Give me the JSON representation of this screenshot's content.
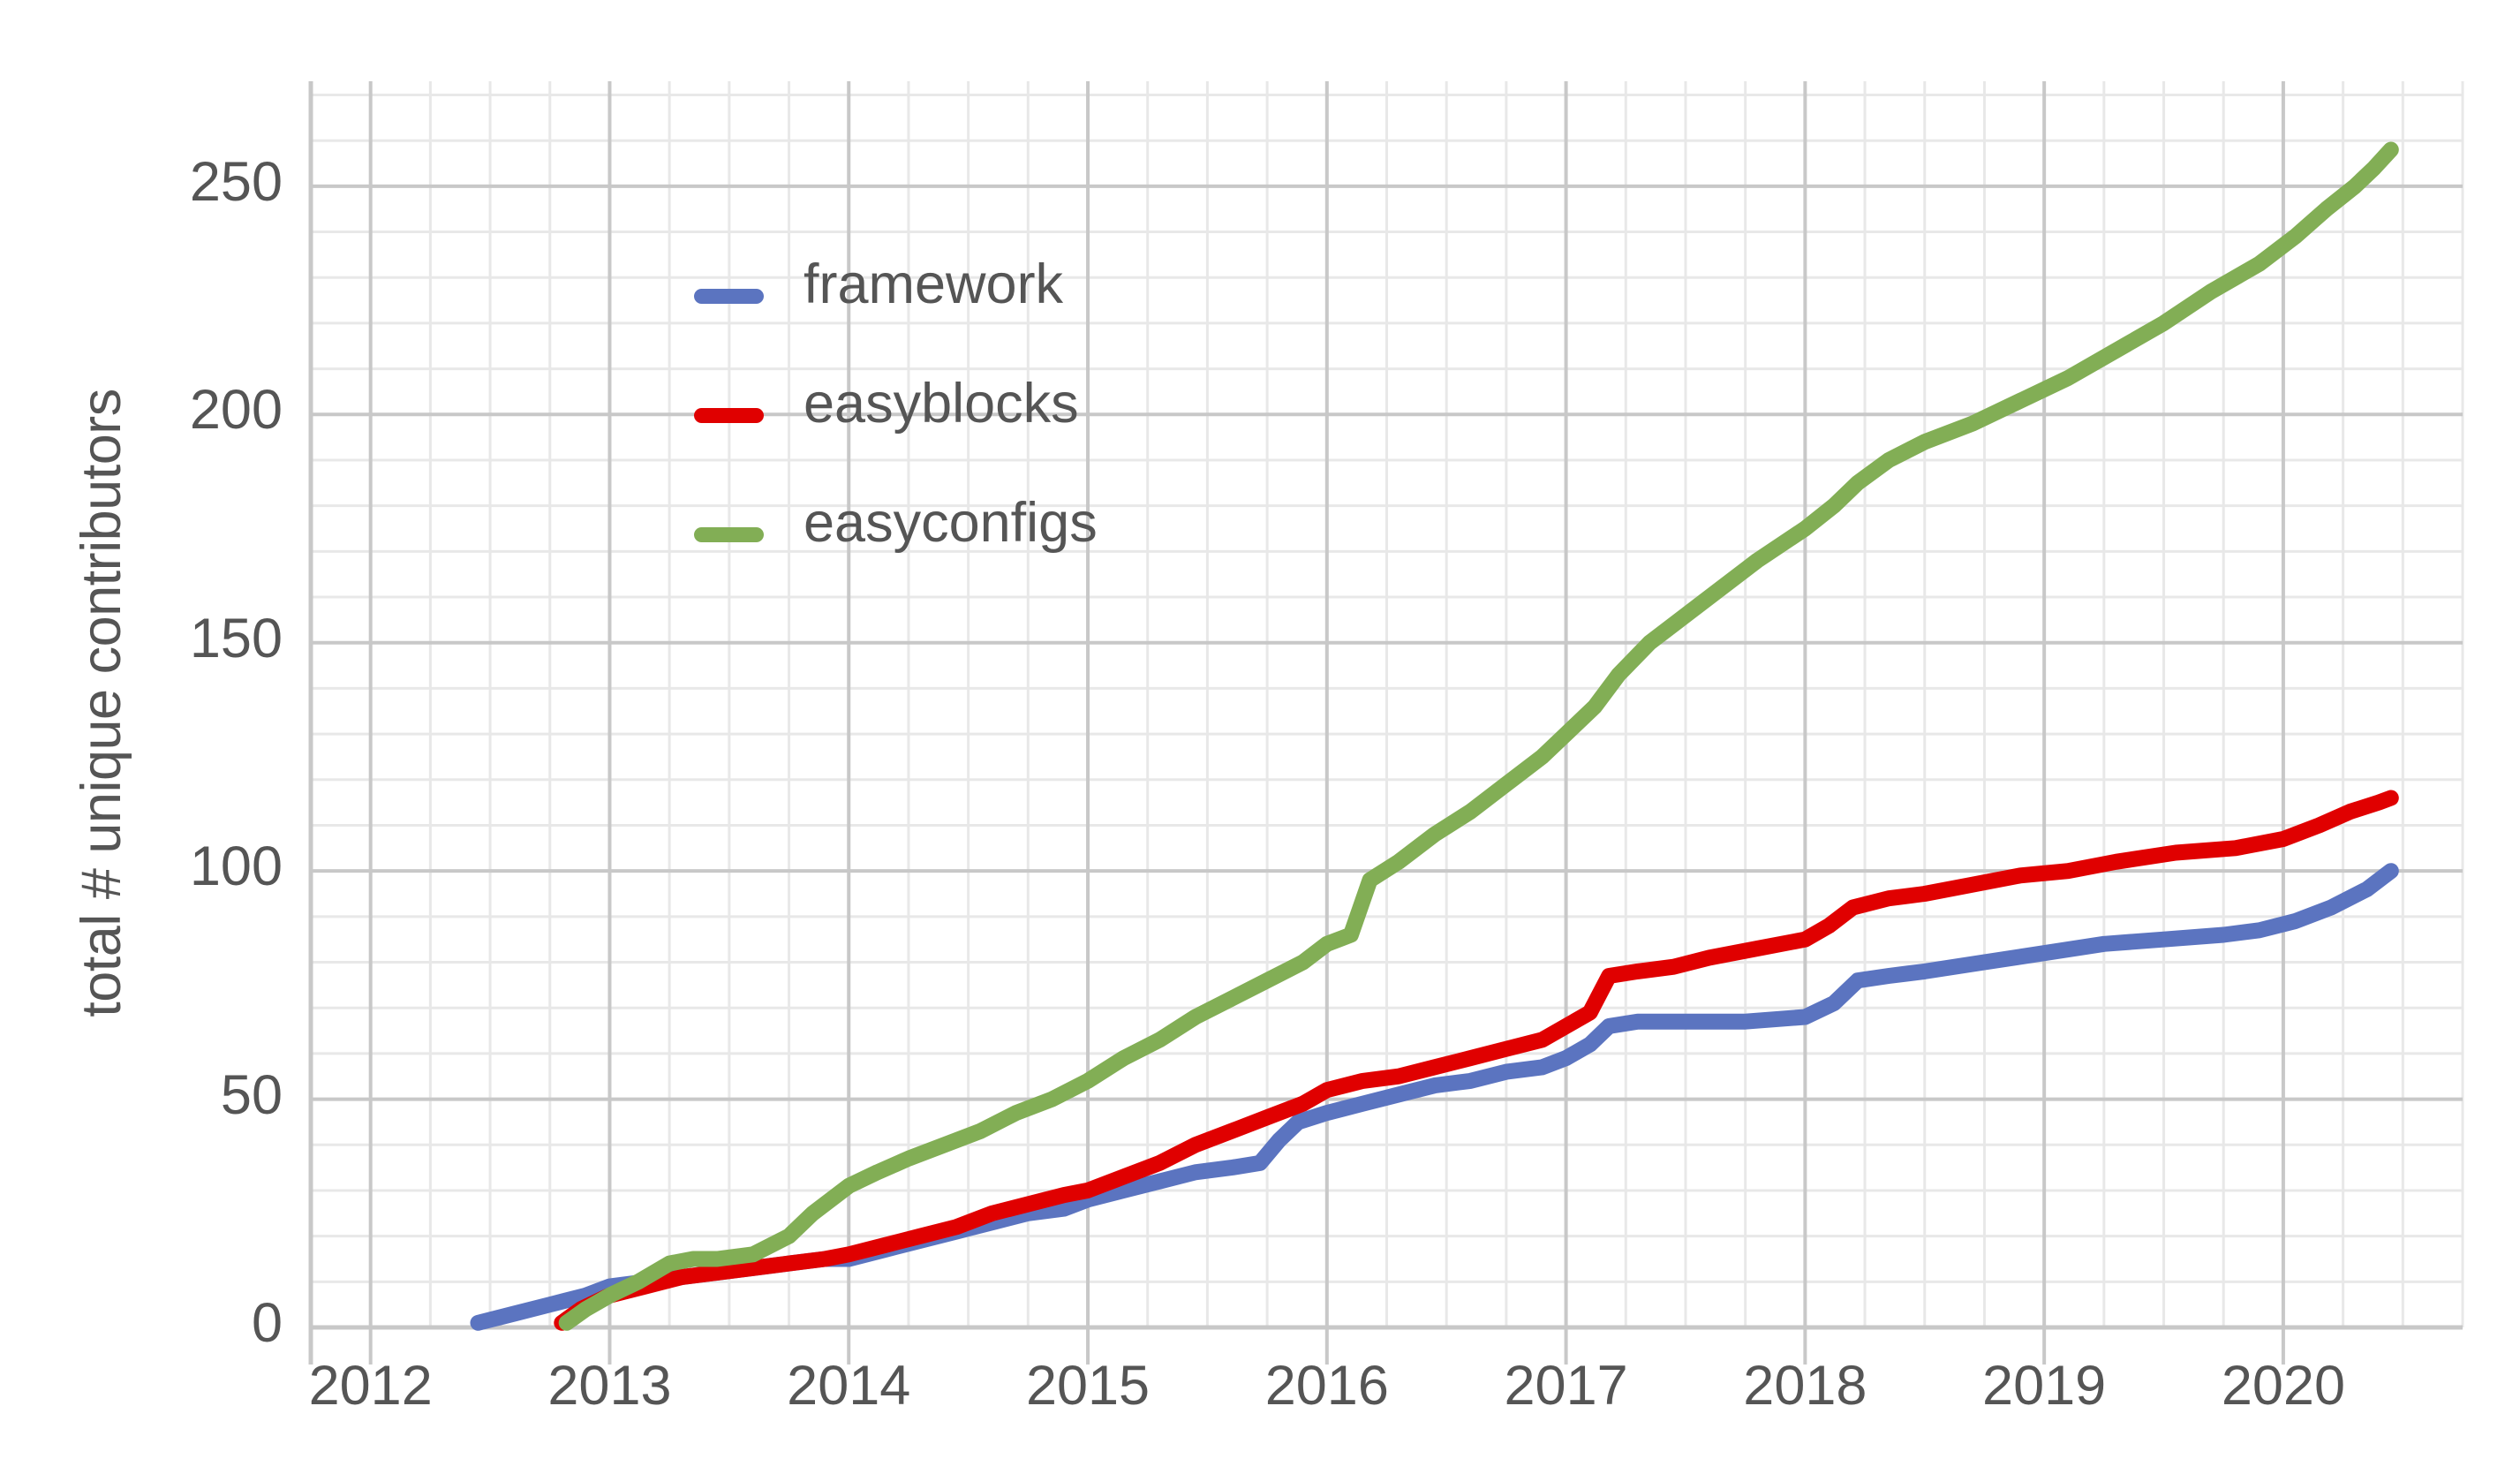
{
  "chart_data": {
    "type": "line",
    "title": "",
    "xlabel": "",
    "ylabel": "total # unique contributors",
    "xlim": [
      2011.75,
      2020.75
    ],
    "ylim": [
      0,
      273
    ],
    "yticks": [
      0,
      50,
      100,
      150,
      200,
      250
    ],
    "xticks": [
      2012,
      2013,
      2014,
      2015,
      2016,
      2017,
      2018,
      2019,
      2020
    ],
    "grid": true,
    "grid_minor_x": "quarterly",
    "grid_minor_y": 10,
    "legend_position": "upper-left-inside",
    "colors": {
      "framework": "#5B74C0",
      "easyblocks": "#E00000",
      "easyconfigs": "#82AE55",
      "axis_text": "#555555",
      "gridline_major": "#c8c8c8",
      "gridline_minor": "#e8e8e8",
      "background": "#ffffff"
    },
    "series": [
      {
        "name": "framework",
        "color": "#5B74C0",
        "x": [
          2012.45,
          2012.6,
          2012.75,
          2012.9,
          2013.0,
          2013.15,
          2013.3,
          2013.45,
          2013.6,
          2013.75,
          2013.9,
          2014.0,
          2014.15,
          2014.3,
          2014.45,
          2014.6,
          2014.75,
          2014.9,
          2015.0,
          2015.15,
          2015.3,
          2015.45,
          2015.6,
          2015.72,
          2015.8,
          2015.88,
          2016.0,
          2016.15,
          2016.3,
          2016.45,
          2016.6,
          2016.75,
          2016.9,
          2017.0,
          2017.1,
          2017.18,
          2017.3,
          2017.5,
          2017.75,
          2018.0,
          2018.12,
          2018.22,
          2018.35,
          2018.5,
          2018.75,
          2019.0,
          2019.25,
          2019.5,
          2019.75,
          2019.9,
          2020.05,
          2020.2,
          2020.35,
          2020.45
        ],
        "y": [
          1,
          3,
          5,
          7,
          9,
          10,
          11,
          12,
          13,
          14,
          15,
          15,
          17,
          19,
          21,
          23,
          25,
          26,
          28,
          30,
          32,
          34,
          35,
          36,
          41,
          45,
          47,
          49,
          51,
          53,
          54,
          56,
          57,
          59,
          62,
          66,
          67,
          67,
          67,
          68,
          71,
          76,
          77,
          78,
          80,
          82,
          84,
          85,
          86,
          87,
          89,
          92,
          96,
          100
        ],
        "final_value": 100
      },
      {
        "name": "easyblocks",
        "color": "#E00000",
        "x": [
          2012.8,
          2012.88,
          2013.0,
          2013.15,
          2013.3,
          2013.45,
          2013.6,
          2013.75,
          2013.9,
          2014.0,
          2014.15,
          2014.3,
          2014.45,
          2014.6,
          2014.75,
          2014.9,
          2015.0,
          2015.15,
          2015.3,
          2015.45,
          2015.6,
          2015.75,
          2015.9,
          2016.0,
          2016.15,
          2016.3,
          2016.45,
          2016.6,
          2016.75,
          2016.9,
          2017.0,
          2017.1,
          2017.18,
          2017.3,
          2017.45,
          2017.6,
          2017.8,
          2018.0,
          2018.1,
          2018.2,
          2018.35,
          2018.5,
          2018.7,
          2018.9,
          2019.1,
          2019.3,
          2019.55,
          2019.8,
          2020.0,
          2020.15,
          2020.28,
          2020.4,
          2020.45
        ],
        "y": [
          1,
          4,
          7,
          9,
          11,
          12,
          13,
          14,
          15,
          16,
          18,
          20,
          22,
          25,
          27,
          29,
          30,
          33,
          36,
          40,
          43,
          46,
          49,
          52,
          54,
          55,
          57,
          59,
          61,
          63,
          66,
          69,
          77,
          78,
          79,
          81,
          83,
          85,
          88,
          92,
          94,
          95,
          97,
          99,
          100,
          102,
          104,
          105,
          107,
          110,
          113,
          115,
          116
        ],
        "final_value": 116
      },
      {
        "name": "easyconfigs",
        "color": "#82AE55",
        "x": [
          2012.82,
          2012.9,
          2013.0,
          2013.12,
          2013.25,
          2013.35,
          2013.45,
          2013.6,
          2013.75,
          2013.85,
          2014.0,
          2014.12,
          2014.25,
          2014.4,
          2014.55,
          2014.7,
          2014.85,
          2015.0,
          2015.15,
          2015.3,
          2015.45,
          2015.6,
          2015.75,
          2015.9,
          2016.0,
          2016.1,
          2016.18,
          2016.3,
          2016.45,
          2016.6,
          2016.75,
          2016.9,
          2017.0,
          2017.12,
          2017.22,
          2017.35,
          2017.5,
          2017.65,
          2017.8,
          2018.0,
          2018.12,
          2018.22,
          2018.35,
          2018.5,
          2018.7,
          2018.9,
          2019.1,
          2019.3,
          2019.5,
          2019.7,
          2019.9,
          2020.05,
          2020.18,
          2020.3,
          2020.38,
          2020.45
        ],
        "y": [
          1,
          4,
          7,
          10,
          14,
          15,
          15,
          16,
          20,
          25,
          31,
          34,
          37,
          40,
          43,
          47,
          50,
          54,
          59,
          63,
          68,
          72,
          76,
          80,
          84,
          86,
          98,
          102,
          108,
          113,
          119,
          125,
          130,
          136,
          143,
          150,
          156,
          162,
          168,
          175,
          180,
          185,
          190,
          194,
          198,
          203,
          208,
          214,
          220,
          227,
          233,
          239,
          245,
          250,
          254,
          258
        ],
        "final_value": 258
      }
    ]
  },
  "axes": {
    "y_title": "total # unique contributors",
    "y_tick_labels": [
      "0",
      "50",
      "100",
      "150",
      "200",
      "250"
    ],
    "x_tick_labels": [
      "2012",
      "2013",
      "2014",
      "2015",
      "2016",
      "2017",
      "2018",
      "2019",
      "2020"
    ]
  },
  "legend": {
    "items": [
      {
        "label": "framework",
        "color": "#5B74C0"
      },
      {
        "label": "easyblocks",
        "color": "#E00000"
      },
      {
        "label": "easyconfigs",
        "color": "#82AE55"
      }
    ]
  }
}
